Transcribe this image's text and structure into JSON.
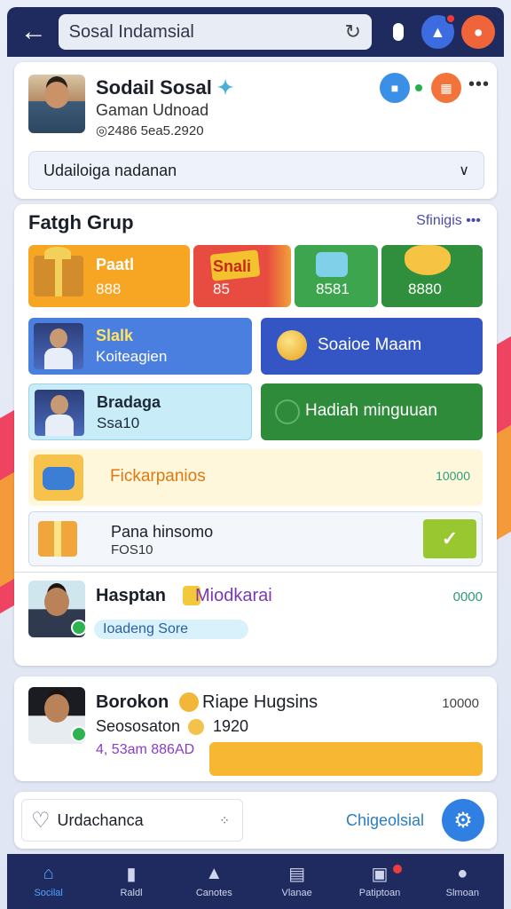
{
  "topbar": {
    "search_value": "Sosal Indamsial"
  },
  "profile": {
    "name": "Sodail Sosal",
    "subtitle": "Gaman Udnoad",
    "stats": "2486 5ea5.2920",
    "dropdown_value": "Udailoiga nadanan"
  },
  "group": {
    "title": "Fatgh Grup",
    "settings_label": "Sfinigis •••",
    "tiles": [
      {
        "t1": "Paatl",
        "t2": "888"
      },
      {
        "t1": "Snali",
        "t2": "85"
      },
      {
        "t1": "",
        "t2": "8581"
      },
      {
        "t1": "",
        "t2": "8880"
      }
    ],
    "blue_tile": {
      "title": "Slalk",
      "sub": "Koiteagien"
    },
    "navy_tile": {
      "label": "Soaioe Maam"
    },
    "cyan_tile": {
      "title": "Bradaga",
      "sub": "Ssa10"
    },
    "green_tile": {
      "label": "Hadiah minguuan"
    },
    "cream_row": {
      "label": "Fickarpanios",
      "num": "10000"
    },
    "gift_row": {
      "title": "Pana hinsomo",
      "sub": "FOS10"
    },
    "person": {
      "name": "Hasptan",
      "name2": "Miodkarai",
      "num": "0000",
      "chip": "Ioadeng Sore"
    }
  },
  "person2": {
    "name": "Borokon",
    "name2": "Riape Hugsins",
    "num": "10000",
    "sub": "Seososaton",
    "sub_num": "1920",
    "tag": "4, 53am 886AD"
  },
  "action": {
    "fav_label": "Urdachanca",
    "link": "Chigeolsial"
  },
  "nav": [
    {
      "label": "Socilal"
    },
    {
      "label": "Raldl"
    },
    {
      "label": "Canotes"
    },
    {
      "label": "Vlanae"
    },
    {
      "label": "Patiptoan"
    },
    {
      "label": "Slmoan"
    }
  ],
  "colors": {
    "topbar": "#1f2a5e",
    "accent_blue": "#2f80e2",
    "orange": "#f6a623",
    "green": "#2e8b3a"
  }
}
